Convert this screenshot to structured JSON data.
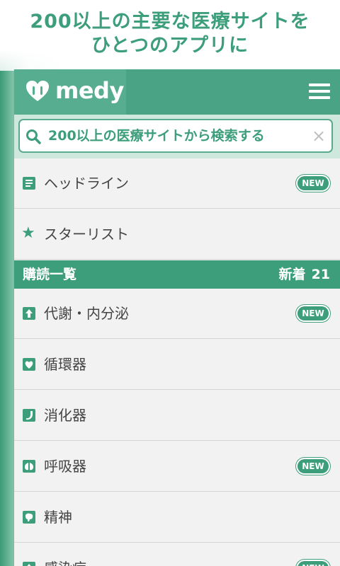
{
  "promo": {
    "line1": "200以上の主要な医療サイトを",
    "line2": "ひとつのアプリに"
  },
  "app": {
    "logo": "medy",
    "search_placeholder": "200以上の医療サイトから検索する"
  },
  "menu": [
    {
      "label": "ヘッドライン",
      "badge": "NEW",
      "icon": "document-icon"
    },
    {
      "label": "スターリスト",
      "badge": "",
      "icon": "star-icon"
    }
  ],
  "section": {
    "title": "購読一覧",
    "new_label": "新着",
    "new_count": "21"
  },
  "categories": [
    {
      "label": "代謝・内分泌",
      "badge": "NEW",
      "icon": "metabolism-icon"
    },
    {
      "label": "循環器",
      "badge": "",
      "icon": "heart-organ-icon"
    },
    {
      "label": "消化器",
      "badge": "",
      "icon": "stomach-icon"
    },
    {
      "label": "呼吸器",
      "badge": "NEW",
      "icon": "lungs-icon"
    },
    {
      "label": "精神",
      "badge": "",
      "icon": "brain-icon"
    },
    {
      "label": "感染症",
      "badge": "NEW",
      "icon": "virus-icon"
    }
  ],
  "colors": {
    "brand_green": "#3d9e7c",
    "header_green": "#4aa385",
    "row_bg": "#f2f2f2"
  }
}
